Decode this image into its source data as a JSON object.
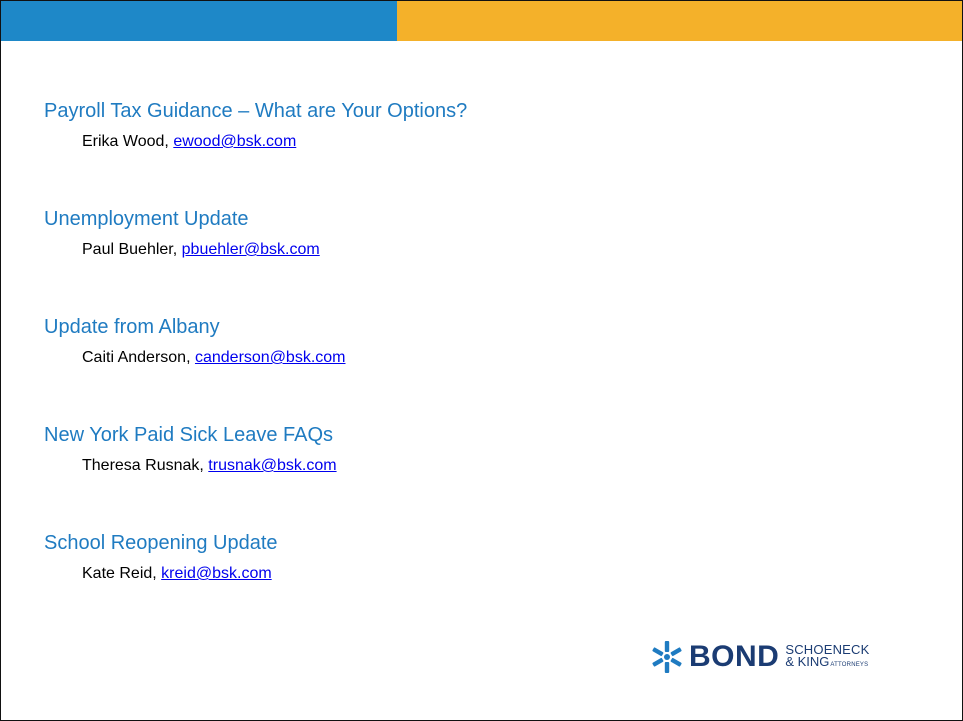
{
  "colors": {
    "blue_bar": "#1E88C8",
    "gold_bar": "#F4B12A",
    "title_blue": "#1F7BC1",
    "link_blue": "#0000EE",
    "logo_navy": "#1B3C73"
  },
  "sessions": [
    {
      "title": "Payroll Tax Guidance – What are Your Options?",
      "presenter_name": "Erika Wood,",
      "email": "ewood@bsk.com"
    },
    {
      "title": "Unemployment Update",
      "presenter_name": "Paul Buehler,",
      "email": "pbuehler@bsk.com"
    },
    {
      "title": "Update from Albany",
      "presenter_name": "Caiti Anderson,",
      "email": "canderson@bsk.com"
    },
    {
      "title": "New York Paid Sick Leave FAQs",
      "presenter_name": "Theresa Rusnak,",
      "email": "trusnak@bsk.com"
    },
    {
      "title": "School Reopening Update",
      "presenter_name": "Kate Reid,",
      "email": "kreid@bsk.com"
    }
  ],
  "logo": {
    "icon": "snowflake-star-icon",
    "word": "BOND",
    "line1": "SCHOENECK",
    "line2": "& KING",
    "line2_small": "ATTORNEYS"
  }
}
